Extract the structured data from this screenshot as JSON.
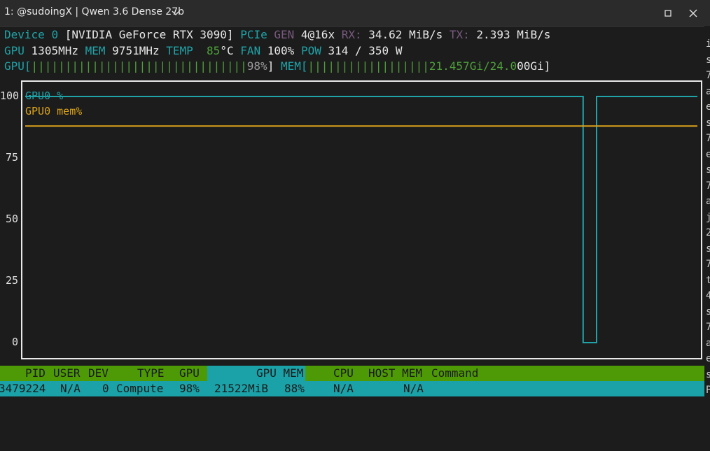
{
  "window": {
    "title": "1: @sudoingX | Qwen 3.6 Dense 27b",
    "icons": {
      "chevron": "chevron-down-icon",
      "maximize": "maximize-icon",
      "close": "close-icon"
    }
  },
  "device": {
    "label": "Device",
    "index": "0",
    "name": "[NVIDIA GeForce RTX 3090]",
    "pcie_label": "PCIe",
    "gen_label": "GEN",
    "gen_value": "4@16x",
    "rx_label": "RX:",
    "rx_value": "34.62 MiB/s",
    "tx_label": "TX:",
    "tx_value": "2.393 MiB/s"
  },
  "stats": {
    "gpu_label": "GPU",
    "gpu_clock": "1305MHz",
    "mem_label": "MEM",
    "mem_clock": "9751MHz",
    "temp_label": "TEMP",
    "temp_value": "85",
    "temp_unit": "°C",
    "fan_label": "FAN",
    "fan_value": "100%",
    "pow_label": "POW",
    "pow_value": "314 / 350 W"
  },
  "bars": {
    "gpu_label": "GPU[",
    "gpu_bar": "||||||||||||||||||||||||||||||||",
    "gpu_value": "98%",
    "gpu_close": "]",
    "mem_label": "MEM[",
    "mem_bar": "||||||||||||||||||",
    "mem_value_hi": "21.457Gi/24.0",
    "mem_value_lo": "00Gi",
    "mem_close": "]",
    "gpu_util_fraction": 0.98,
    "mem_used_fraction": 0.894
  },
  "chart_data": {
    "type": "line",
    "yticks": [
      "100",
      "75",
      "50",
      "25",
      "0"
    ],
    "ylim": [
      0,
      100
    ],
    "xlim": [
      0,
      100
    ],
    "series": [
      {
        "name": "GPU0 %",
        "color": "#1fa3a8",
        "x": [
          0,
          83.0,
          83.0,
          85.0,
          85.0,
          100
        ],
        "y": [
          100,
          100,
          0,
          0,
          100,
          100
        ]
      },
      {
        "name": "GPU0 mem%",
        "color": "#d9a21b",
        "x": [
          0,
          100
        ],
        "y": [
          88,
          88
        ]
      }
    ]
  },
  "process_table": {
    "headers": [
      "PID",
      "USER",
      "DEV",
      "TYPE",
      "GPU",
      "GPU MEM",
      "CPU",
      "HOST MEM",
      "Command"
    ],
    "header_color": "#4e9a06",
    "gpu_mem_header_color": "#1aa2a8",
    "rows": [
      {
        "pid": "3479224",
        "user": "N/A",
        "dev": "0",
        "type": "Compute",
        "gpu": "98%",
        "gpu_mem": "21522MiB",
        "gpu_mem_pct": "88%",
        "cpu": "N/A",
        "host_mem": "N/A",
        "command": ""
      }
    ]
  },
  "side_glyphs": [
    "i",
    "s",
    "7",
    "a",
    "e",
    "s",
    "7",
    "e",
    "s",
    "7",
    "a",
    "j",
    "2",
    "s",
    "7",
    "t",
    "4",
    "s",
    "7",
    "a",
    "e",
    "s",
    "P"
  ]
}
